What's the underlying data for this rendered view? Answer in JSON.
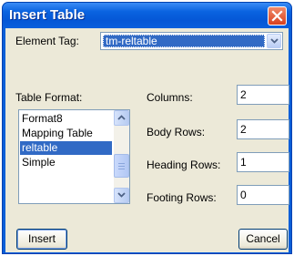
{
  "window": {
    "title": "Insert Table"
  },
  "element_tag": {
    "label": "Element Tag:",
    "value": "tm-reltable"
  },
  "table_format": {
    "label": "Table Format:",
    "items": [
      {
        "label": "Format8",
        "selected": false
      },
      {
        "label": "Mapping Table",
        "selected": false
      },
      {
        "label": "reltable",
        "selected": true
      },
      {
        "label": "Simple",
        "selected": false
      }
    ]
  },
  "columns": {
    "label": "Columns:",
    "value": "2"
  },
  "body_rows": {
    "label": "Body Rows:",
    "value": "2"
  },
  "heading_rows": {
    "label": "Heading Rows:",
    "value": "1"
  },
  "footing_rows": {
    "label": "Footing Rows:",
    "value": "0"
  },
  "buttons": {
    "insert": "Insert",
    "cancel": "Cancel"
  },
  "icons": {
    "close": "close-icon",
    "dropdown": "chevron-down-icon",
    "scroll_up": "scroll-up-arrow-icon",
    "scroll_down": "scroll-down-arrow-icon"
  }
}
